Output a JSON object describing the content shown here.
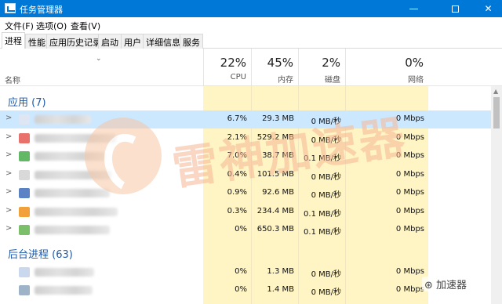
{
  "window": {
    "title": "任务管理器",
    "minimize": "—",
    "close": "✕"
  },
  "menu": [
    "文件(F)",
    "选项(O)",
    "查看(V)"
  ],
  "tabs": [
    "进程",
    "性能",
    "应用历史记录",
    "启动",
    "用户",
    "详细信息",
    "服务"
  ],
  "header": {
    "name_label": "名称",
    "cpu": {
      "percent": "22%",
      "label": "CPU"
    },
    "memory": {
      "percent": "45%",
      "label": "内存"
    },
    "disk": {
      "percent": "2%",
      "label": "磁盘"
    },
    "network": {
      "percent": "0%",
      "label": "网络"
    }
  },
  "groups": {
    "apps_title": "应用 (7)",
    "background_title": "后台进程 (63)"
  },
  "apps": [
    {
      "cpu": "6.7%",
      "mem": "29.3 MB",
      "disk": "0 MB/秒",
      "net": "0 Mbps",
      "icon_color": "#dde6f2"
    },
    {
      "cpu": "2.1%",
      "mem": "529.2 MB",
      "disk": "0 MB/秒",
      "net": "0 Mbps",
      "icon_color": "#e8716b"
    },
    {
      "cpu": "7.0%",
      "mem": "38.7 MB",
      "disk": "0.1 MB/秒",
      "net": "0 Mbps",
      "icon_color": "#63b866"
    },
    {
      "cpu": "0.4%",
      "mem": "101.5 MB",
      "disk": "0 MB/秒",
      "net": "0 Mbps",
      "icon_color": "#d9d9d9"
    },
    {
      "cpu": "0.9%",
      "mem": "92.6 MB",
      "disk": "0 MB/秒",
      "net": "0 Mbps",
      "icon_color": "#5a82c4"
    },
    {
      "cpu": "0.3%",
      "mem": "234.4 MB",
      "disk": "0.1 MB/秒",
      "net": "0 Mbps",
      "icon_color": "#f2a13a"
    },
    {
      "cpu": "0%",
      "mem": "650.3 MB",
      "disk": "0.1 MB/秒",
      "net": "0 Mbps",
      "icon_color": "#7bbf6a"
    }
  ],
  "background": [
    {
      "cpu": "0%",
      "mem": "1.3 MB",
      "disk": "0 MB/秒",
      "net": "0 Mbps",
      "icon_color": "#c9d8ec"
    },
    {
      "cpu": "0%",
      "mem": "1.4 MB",
      "disk": "0 MB/秒",
      "net": "0 Mbps",
      "icon_color": "#9fb3c8"
    }
  ],
  "expander": ">",
  "sort_arrow": "⌄",
  "watermark": {
    "text": "雷神加速器"
  },
  "corner_badge": "加速器",
  "accent": "#0078d7"
}
